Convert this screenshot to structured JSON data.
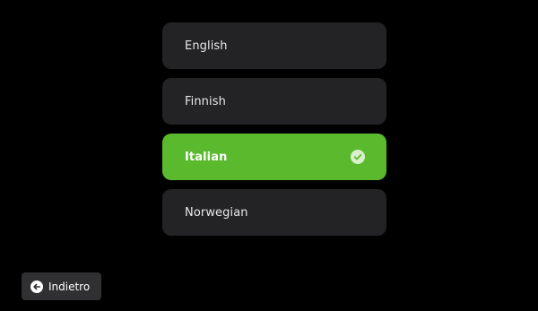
{
  "languages": {
    "items": [
      {
        "label": "English",
        "selected": false
      },
      {
        "label": "Finnish",
        "selected": false
      },
      {
        "label": "Italian",
        "selected": true
      },
      {
        "label": "Norwegian",
        "selected": false
      }
    ]
  },
  "back": {
    "label": "Indietro",
    "icon": "arrow-left-circle-icon"
  },
  "colors": {
    "background": "#000000",
    "item_background": "#232326",
    "selected_background": "#5bb92e",
    "button_background": "#303033"
  }
}
